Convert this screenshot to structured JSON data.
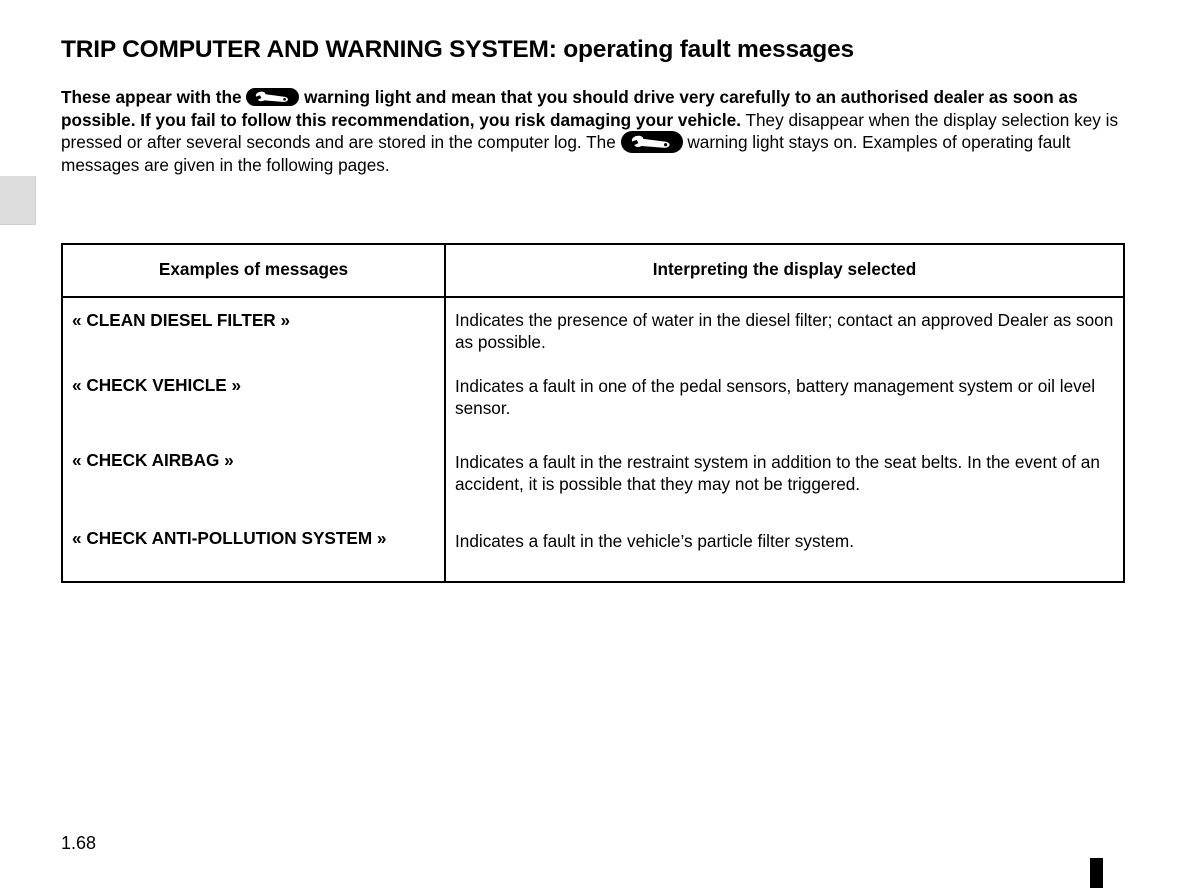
{
  "document": {
    "title": "TRIP COMPUTER AND WARNING SYSTEM: operating fault messages",
    "page_number": "1.68"
  },
  "intro": {
    "bold_part_1": "These appear with the",
    "icon_1": "wrench-warning-light-icon",
    "bold_part_2": "warning light and mean that you should drive very carefully to an authorised dealer as soon as possible. If you fail to follow this recommendation, you risk damaging your vehicle.",
    "normal_part_1": "They disappear when the display selection key is pressed or after several seconds and are stored in the computer log. The",
    "icon_2": "wrench-warning-light-icon",
    "normal_part_2": "warning light stays on. Examples of operating fault messages are given in the following pages."
  },
  "table": {
    "headers": {
      "left": "Examples of messages",
      "right": "Interpreting the display selected"
    },
    "rows": [
      {
        "message": "« CLEAN DIESEL FILTER »",
        "interpretation": "Indicates the presence of water in the diesel filter; contact an approved Dealer as soon as possible."
      },
      {
        "message": "« CHECK VEHICLE »",
        "interpretation": "Indicates a fault in one of the pedal sensors, battery management system or oil level sensor."
      },
      {
        "message": "« CHECK AIRBAG »",
        "interpretation": "Indicates a fault in the restraint system in addition to the seat belts. In the event of an accident, it is possible that they may not be triggered."
      },
      {
        "message": "« CHECK ANTI-POLLUTION SYSTEM »",
        "interpretation": "Indicates a fault in the vehicle’s particle filter system."
      }
    ]
  },
  "colors": {
    "text": "#000000",
    "page_background": "#ffffff",
    "edge_tab": "#dcdcdc",
    "table_border": "#000000",
    "icon_background": "#000000",
    "icon_glyph": "#ffffff"
  }
}
